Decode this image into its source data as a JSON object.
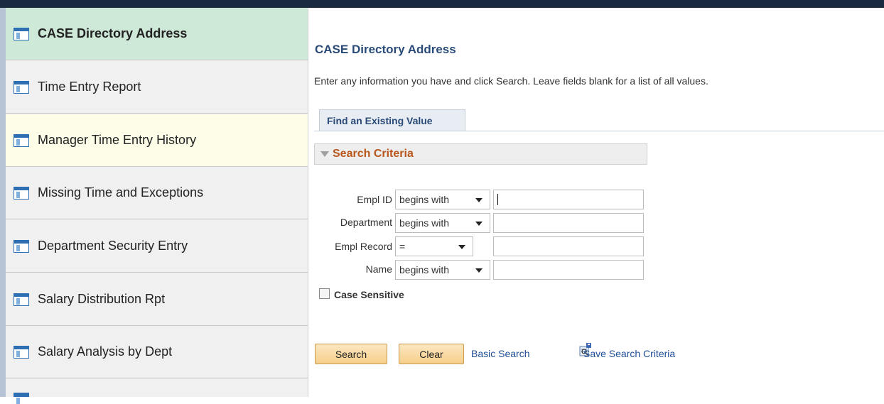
{
  "sidebar": {
    "items": [
      {
        "label": "CASE Directory Address",
        "state": "active"
      },
      {
        "label": "Time Entry Report",
        "state": "normal"
      },
      {
        "label": "Manager Time Entry History",
        "state": "hover"
      },
      {
        "label": "Missing Time and Exceptions",
        "state": "normal"
      },
      {
        "label": "Department Security Entry",
        "state": "normal"
      },
      {
        "label": "Salary Distribution Rpt",
        "state": "normal"
      },
      {
        "label": "Salary Analysis by Dept",
        "state": "normal"
      }
    ],
    "icon": "page-icon"
  },
  "main": {
    "title": "CASE Directory Address",
    "instructions": "Enter any information you have and click Search. Leave fields blank for a list of all values.",
    "tab_label": "Find an Existing Value",
    "section_title": "Search Criteria",
    "fields": [
      {
        "label": "Empl ID",
        "operator": "begins with",
        "value": ""
      },
      {
        "label": "Department",
        "operator": "begins with",
        "value": ""
      },
      {
        "label": "Empl Record",
        "operator": "=",
        "value": ""
      },
      {
        "label": "Name",
        "operator": "begins with",
        "value": ""
      }
    ],
    "case_sensitive_label": "Case Sensitive",
    "case_sensitive_checked": false,
    "search_button": "Search",
    "clear_button": "Clear",
    "basic_search_link": "Basic Search",
    "save_search_link": "Save Search Criteria"
  },
  "colors": {
    "top_bar": "#1b2b3f",
    "active_item": "#cfe9d8",
    "hover_item": "#fdfde8",
    "title": "#2a4a78",
    "section_title": "#b8561b",
    "link": "#1f4e96",
    "button": "#f6cf8c"
  }
}
